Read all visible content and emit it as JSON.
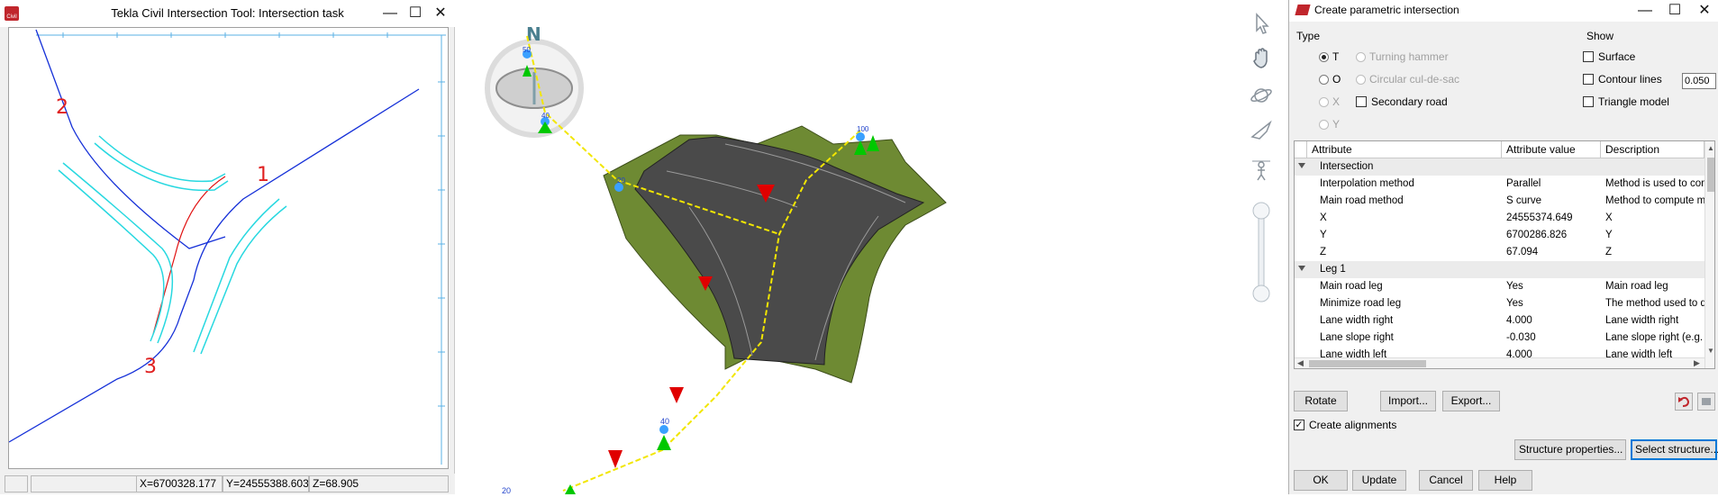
{
  "left_window": {
    "title": "Tekla Civil Intersection Tool: Intersection task",
    "app_icon_label": "Civil",
    "status": {
      "x": "X=6700328.177",
      "y": "Y=24555388.603",
      "z": "Z=68.905"
    },
    "leg_numbers": [
      "1",
      "2",
      "3"
    ]
  },
  "view3d": {
    "compass_label": "N",
    "stations": [
      "50",
      "40",
      "100",
      "20",
      "40",
      "20"
    ],
    "colors": {
      "road": "#4a4a4a",
      "grass": "#6e8a33",
      "alignment": "#f2e600",
      "marker_green": "#00c800",
      "marker_red": "#e00000"
    }
  },
  "toolbar": {
    "icons": [
      "select-arrow-icon",
      "pan-hand-icon",
      "orbit-icon",
      "fly-icon",
      "walk-icon",
      "zoom-slider"
    ]
  },
  "dialog": {
    "title": "Create parametric intersection",
    "type_label": "Type",
    "show_label": "Show",
    "type_options": [
      {
        "label": "T",
        "checked": true,
        "enabled": true
      },
      {
        "label": "O",
        "checked": false,
        "enabled": true
      },
      {
        "label": "X",
        "checked": false,
        "enabled": false
      },
      {
        "label": "Y",
        "checked": false,
        "enabled": false
      }
    ],
    "type_options_right": [
      {
        "label": "Turning hammer",
        "enabled": false
      },
      {
        "label": "Circular cul-de-sac",
        "enabled": false
      }
    ],
    "secondary_road_label": "Secondary road",
    "show_options": [
      {
        "label": "Surface",
        "checked": false
      },
      {
        "label": "Contour lines",
        "checked": false
      },
      {
        "label": "Triangle model",
        "checked": false
      }
    ],
    "contour_value": "0.050",
    "grid": {
      "headers": [
        "Attribute",
        "Attribute value",
        "Description"
      ],
      "rows": [
        {
          "group": true,
          "attribute": "Intersection"
        },
        {
          "attribute": "Interpolation method",
          "value": "Parallel",
          "description": "Method is used to com"
        },
        {
          "attribute": "Main road method",
          "value": "S curve",
          "description": "Method to compute m"
        },
        {
          "attribute": "X",
          "value": "24555374.649",
          "description": "X"
        },
        {
          "attribute": "Y",
          "value": "6700286.826",
          "description": "Y"
        },
        {
          "attribute": "Z",
          "value": "67.094",
          "description": "Z"
        },
        {
          "group": true,
          "attribute": "Leg 1"
        },
        {
          "attribute": "Main road leg",
          "value": "Yes",
          "description": "Main road leg"
        },
        {
          "attribute": "Minimize road leg",
          "value": "Yes",
          "description": "The method used to d"
        },
        {
          "attribute": "Lane width right",
          "value": "4.000",
          "description": "Lane width right"
        },
        {
          "attribute": "Lane slope right",
          "value": "-0.030",
          "description": "Lane slope right (e.g. -"
        },
        {
          "attribute": "Lane width left",
          "value": "4.000",
          "description": "Lane width left"
        }
      ]
    },
    "buttons": {
      "rotate": "Rotate",
      "import": "Import...",
      "export": "Export...",
      "structure_properties": "Structure properties...",
      "select_structure": "Select structure...",
      "ok": "OK",
      "update": "Update",
      "cancel": "Cancel",
      "help": "Help"
    },
    "create_alignments_label": "Create alignments",
    "create_alignments_checked": true
  }
}
